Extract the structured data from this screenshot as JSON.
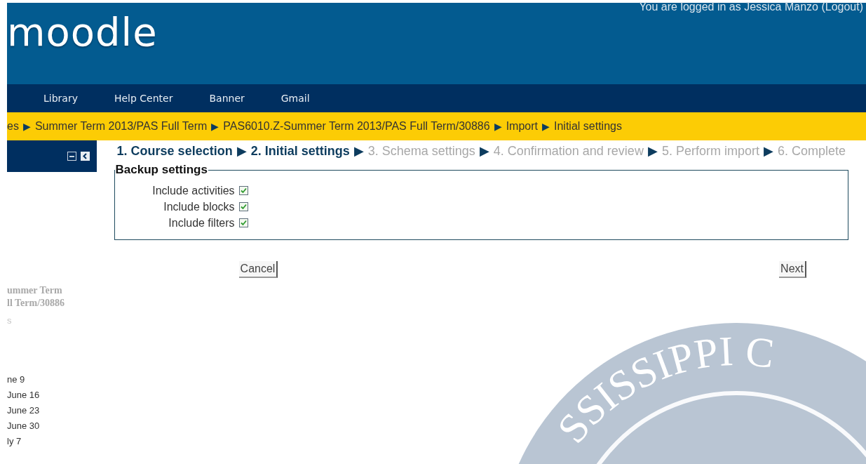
{
  "header": {
    "logo": "moodle",
    "login_info": "You are logged in as Jessica Manzo (Logout)"
  },
  "nav": [
    "Library",
    "Help Center",
    "Banner",
    "Gmail"
  ],
  "breadcrumb": {
    "separator": "▶",
    "items": [
      "es",
      "Summer Term 2013/PAS Full Term",
      "PAS6010.Z-Summer Term 2013/PAS Full Term/30886",
      "Import",
      "Initial settings"
    ]
  },
  "sidebar": {
    "course_lines": [
      "ummer Term",
      "ll Term/30886"
    ],
    "faint_line": "s",
    "weeks": [
      "ne 9",
      "June 16",
      "June 23",
      "June 30",
      "ly 7"
    ]
  },
  "steps": {
    "separator": "▶",
    "items": [
      {
        "label": "1. Course selection",
        "reached": true
      },
      {
        "label": "2. Initial settings",
        "reached": true
      },
      {
        "label": "3. Schema settings",
        "reached": false
      },
      {
        "label": "4. Confirmation and review",
        "reached": false
      },
      {
        "label": "5. Perform import",
        "reached": false
      },
      {
        "label": "6. Complete",
        "reached": false
      }
    ]
  },
  "backup_settings": {
    "legend": "Backup settings",
    "options": [
      {
        "label": "Include activities",
        "checked": true
      },
      {
        "label": "Include blocks",
        "checked": true
      },
      {
        "label": "Include filters",
        "checked": true
      }
    ]
  },
  "buttons": {
    "cancel": "Cancel",
    "next": "Next"
  },
  "seal_text": "SSISSIPPI C"
}
